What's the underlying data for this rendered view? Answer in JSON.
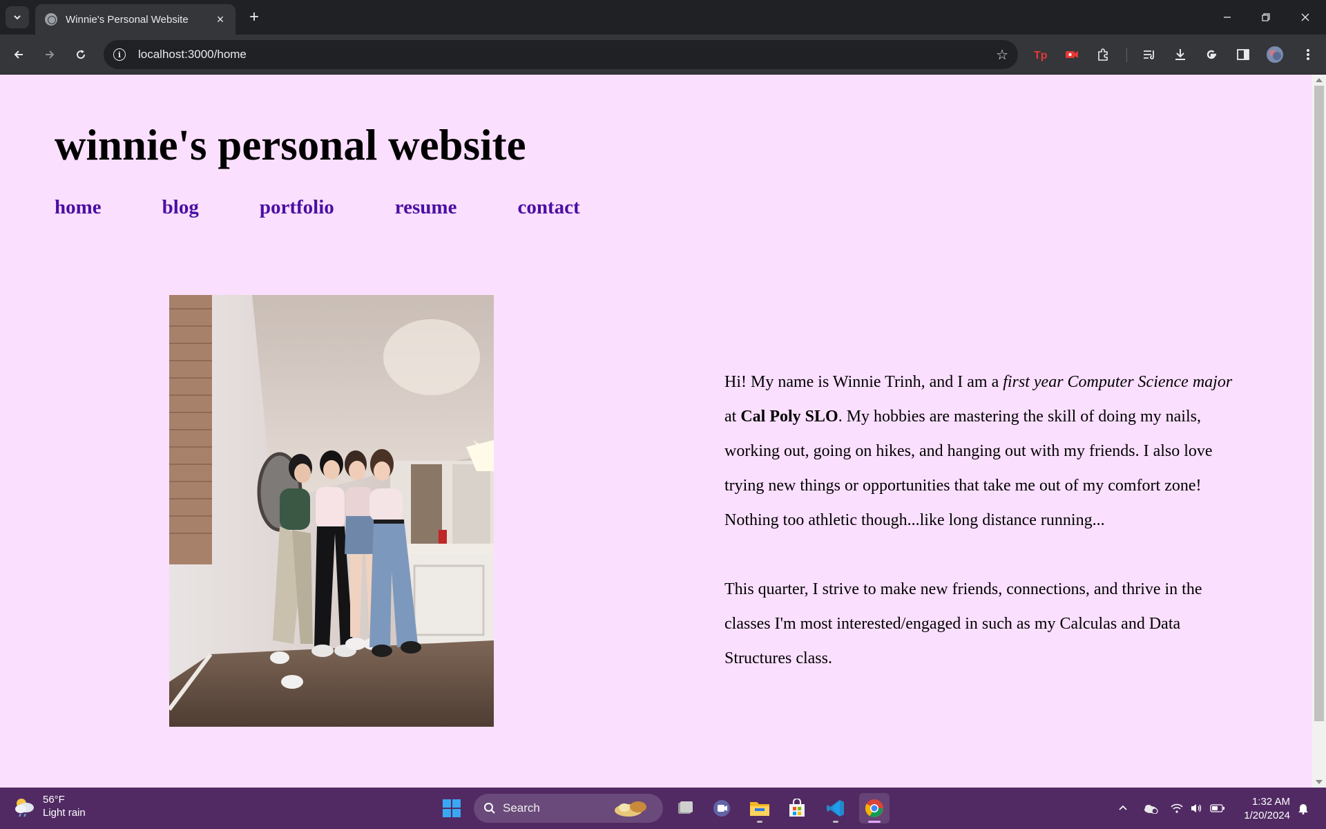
{
  "browser": {
    "tab": {
      "title": "Winnie's Personal Website",
      "close": "×"
    },
    "new_tab": "+",
    "url": "localhost:3000/home",
    "bookmark_star": "☆"
  },
  "site": {
    "title": "winnie's personal website",
    "nav": [
      "home",
      "blog",
      "portfolio",
      "resume",
      "contact"
    ],
    "photo": {
      "description_icon": "group-photo"
    },
    "bio": {
      "p1": {
        "a": "Hi! My name is Winnie Trinh, and I am a ",
        "b": "first year Computer Science major",
        "c": " at ",
        "d": "Cal Poly SLO",
        "e": ". My hobbies are mastering the skill of doing my nails, working out, going on hikes, and hanging out with my friends. I also love trying new things or opportunities that take me out of my comfort zone! Nothing too athletic though...like long distance running..."
      },
      "p2": "This quarter, I strive to make new friends, connections, and thrive in the classes I'm most interested/engaged in such as my Calculas and Data Structures class."
    }
  },
  "taskbar": {
    "weather": {
      "temp": "56°F",
      "condition": "Light rain"
    },
    "search_label": "Search",
    "clock": {
      "time": "1:32 AM",
      "date": "1/20/2024"
    }
  },
  "colors": {
    "page_bg": "#fbdfff",
    "nav_link": "#4a0fa3",
    "taskbar": "#512a63"
  }
}
